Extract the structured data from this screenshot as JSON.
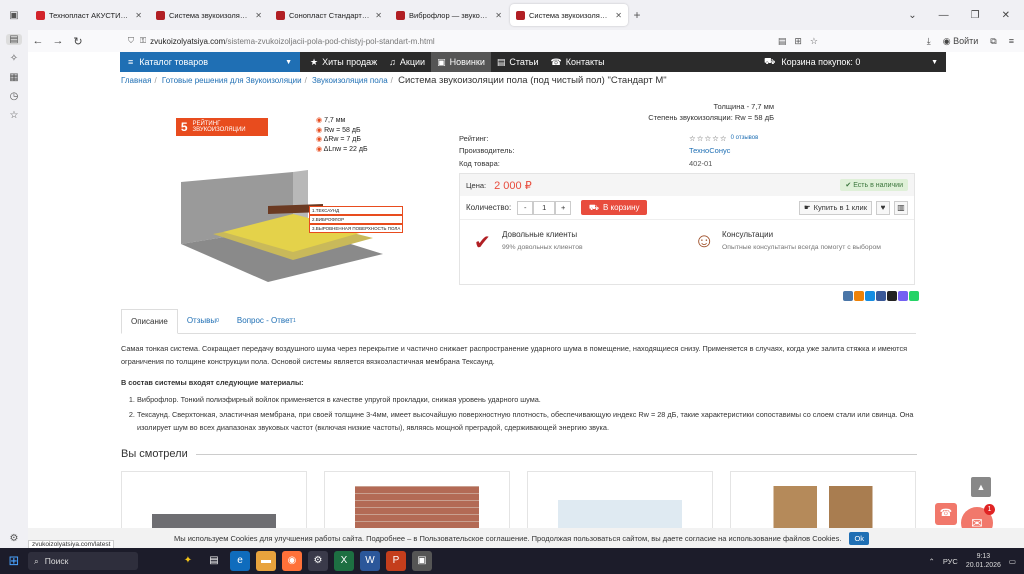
{
  "browser": {
    "tabs": [
      {
        "title": "Технопласт АКУСТИК/АКУСТИ...",
        "fav_color": "#d2232a",
        "active": false
      },
      {
        "title": "Система звукоизоляции пола...",
        "fav_color": "#b11f24",
        "active": false
      },
      {
        "title": "Сонопласт Стандарт Плюс — з...",
        "fav_color": "#b11f24",
        "active": false
      },
      {
        "title": "Виброфлор — звукоизоляция...",
        "fav_color": "#b11f24",
        "active": false
      },
      {
        "title": "Система звукоизоляции пола...",
        "fav_color": "#b11f24",
        "active": true
      }
    ],
    "url_host": "zvukoizolyatsiya.com",
    "url_path": "/sistema-zvukoizoljacii-pola-pod-chistyj-pol-standart-m.html",
    "login_label": "Войти",
    "status_url": "zvukoizolyatsiya.com/latest"
  },
  "nav": {
    "catalog": "Каталог товаров",
    "links": [
      {
        "icon": "★",
        "label": "Хиты продаж",
        "active": false
      },
      {
        "icon": "♫",
        "label": "Акции",
        "active": false
      },
      {
        "icon": "▣",
        "label": "Новинки",
        "active": true
      },
      {
        "icon": "▤",
        "label": "Статьи",
        "active": false
      },
      {
        "icon": "☎",
        "label": "Контакты",
        "active": false
      }
    ],
    "cart": "Корзина покупок: 0"
  },
  "breadcrumb": {
    "items": [
      "Главная",
      "Готовые решения для Звукоизоляции",
      "Звукоизоляция пола"
    ],
    "current": "Система звукоизоляции пола (под чистый пол) \"Стандарт М\""
  },
  "specs_top": {
    "thickness": "Толщина - 7,7 мм",
    "insulation": "Степень звукоизоляции: Rw = 58 дБ"
  },
  "image": {
    "rating_num": "5",
    "rating_label": "РЕЙТИНГ ЗВУКОИЗОЛЯЦИИ",
    "spec1": "7,7 мм",
    "spec2": "Rw = 58 дБ",
    "spec3": "ΔRw = 7 дБ",
    "spec4": "ΔLnw = 22 дБ",
    "layer1": "1.ТЕКСАУНД",
    "layer2": "2.ВИБРОФЛОР",
    "layer3": "3.ВЫРОВНЕННАЯ ПОВЕРХНОСТЬ ПОЛА"
  },
  "props": {
    "rating_key": "Рейтинг:",
    "reviews": "0 отзывов",
    "maker_key": "Производитель:",
    "maker_val": "ТехноСонус",
    "code_key": "Код товара:",
    "code_val": "402-01"
  },
  "buy": {
    "price_key": "Цена:",
    "price_val": "2 000 ₽",
    "in_stock": "Есть в наличии",
    "qty_key": "Количество:",
    "qty_val": "1",
    "tocart": "В корзину",
    "oneclick": "Купить в 1 клик",
    "f1_title": "Довольные клиенты",
    "f1_desc": "99% довольных клиентов",
    "f2_title": "Консультации",
    "f2_desc": "Опытные консультанты всегда помогут с выбором"
  },
  "tabs": [
    {
      "label": "Описание",
      "count": "",
      "active": true
    },
    {
      "label": "Отзывы",
      "count": "0",
      "active": false
    },
    {
      "label": "Вопрос - Ответ",
      "count": "1",
      "active": false
    }
  ],
  "desc": {
    "p1": "Самая тонкая система. Сокращает передачу воздушного шума через перекрытие и частично снижает распространение ударного шума в помещение, находящиеся снизу. Применяется в случаях, когда уже залита стяжка и имеются ограничения по толщине конструкции пола. Основой системы является вязкоэластичная мембрана Тексаунд.",
    "p2": "В состав системы входят следующие материалы:",
    "li1": "Виброфлор. Тонкий полиэфирный войлок применяется в качестве упругой прокладки, снижая уровень ударного шума.",
    "li2": "Тексаунд. Сверхтонкая, эластичная мембрана, при своей толщине 3-4мм, имеет высочайшую поверхностную плотность, обеспечивающую индекс Rw = 28 дБ, такие характеристики сопоставимы со слоем стали или свинца. Она изолирует шум во всех диапазонах звуковых частот (включая низкие частоты), являясь мощной преградой, сдерживающей энергию звука."
  },
  "seen_title": "Вы смотрели",
  "cookie": {
    "msg": "Мы используем Cookies для улучшения работы сайта. Подробнее – в Пользовательское соглашение. Продолжая пользоваться сайтом, вы даете согласие на использование файлов Cookies.",
    "ok": "Ok"
  },
  "chat_badge": "1",
  "taskbar": {
    "search": "Поиск",
    "lang": "РУС",
    "time": "9:13",
    "date": "20.01.2026"
  }
}
